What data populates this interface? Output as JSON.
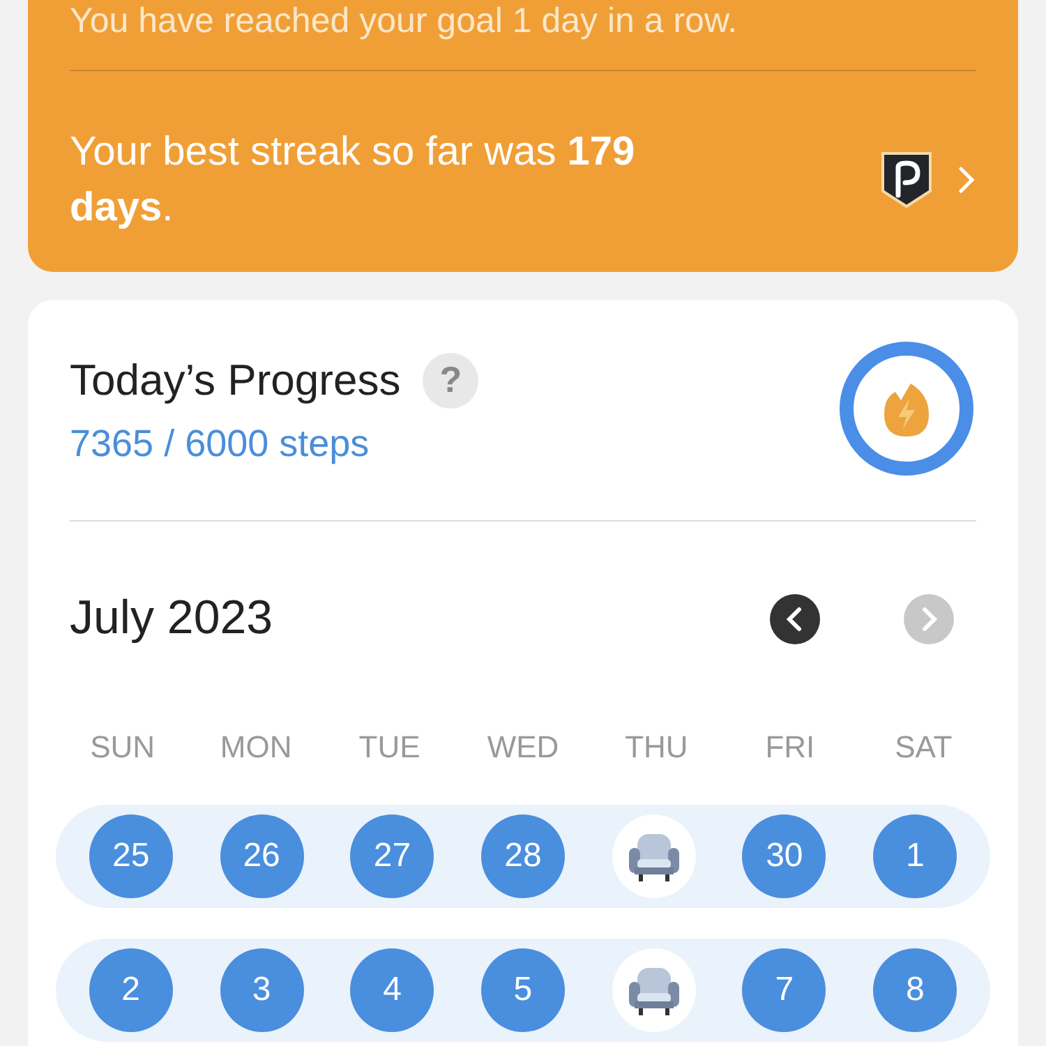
{
  "streak_card": {
    "message": "You have reached your goal 1 day in a row.",
    "best": "Your best streak so far was **179 days**."
  },
  "progress": {
    "title": "Today’s Progress",
    "help": "?",
    "steps": "7365 / 6000 steps",
    "level": 1
  },
  "calendar": {
    "month": "July 2023",
    "nav": [
      {
        "kind": "prev",
        "disabled": false
      },
      {
        "kind": "next",
        "disabled": true
      }
    ],
    "weekdays": [
      "SUN",
      "MON",
      "TUE",
      "WED",
      "THU",
      "FRI",
      "SAT"
    ],
    "weeks": [
      [
        {
          "kind": "goal",
          "label": "25"
        },
        {
          "kind": "goal",
          "label": "26"
        },
        {
          "kind": "goal",
          "label": "27"
        },
        {
          "kind": "goal",
          "label": "28"
        },
        {
          "kind": "rest"
        },
        {
          "kind": "goal",
          "label": "30"
        },
        {
          "kind": "goal",
          "label": "1"
        }
      ],
      [
        {
          "kind": "goal",
          "label": "2"
        },
        {
          "kind": "goal",
          "label": "3"
        },
        {
          "kind": "goal",
          "label": "4"
        },
        {
          "kind": "goal",
          "label": "5"
        },
        {
          "kind": "rest"
        },
        {
          "kind": "goal",
          "label": "7"
        },
        {
          "kind": "goal",
          "label": "8"
        }
      ]
    ]
  }
}
